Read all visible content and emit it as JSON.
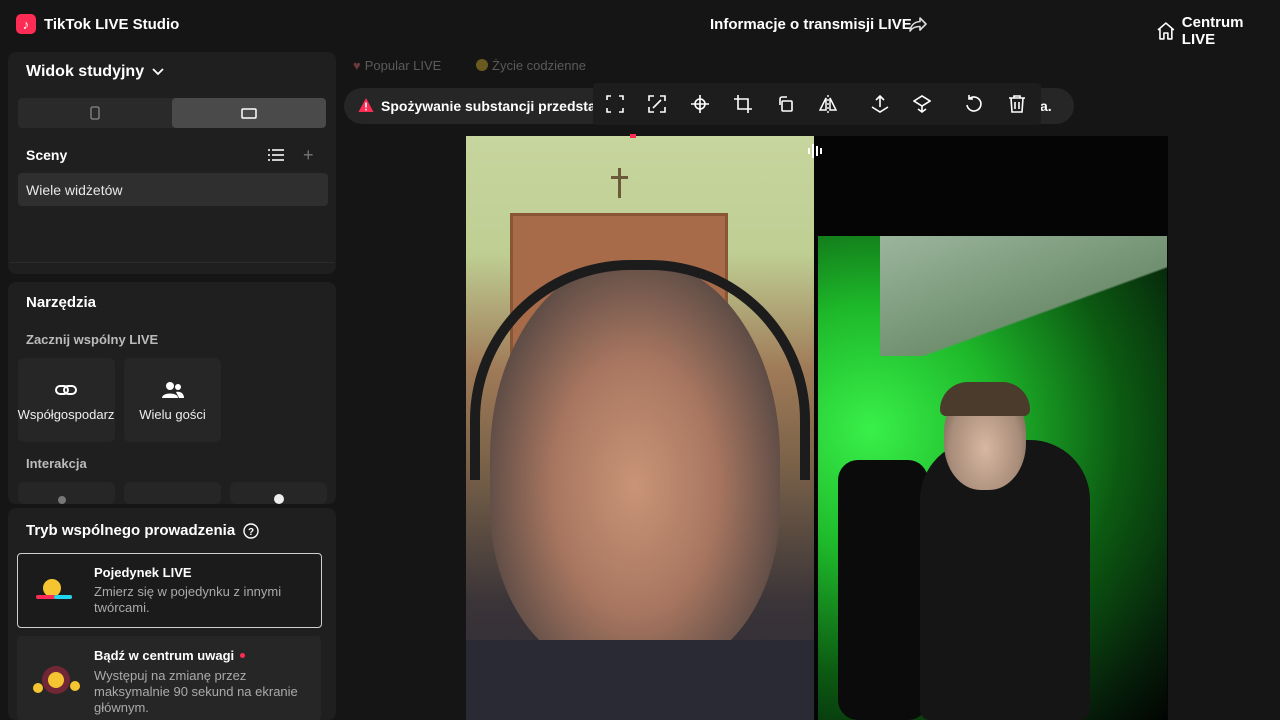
{
  "app": {
    "title": "TikTok LIVE Studio",
    "logo_icon": "tiktok-logo",
    "live_info": "Informacje o transmisji LIVE",
    "centrum": "Centrum LIVE",
    "accent_color": "#fe2c55"
  },
  "sidebar": {
    "studio_view": "Widok studyjny",
    "scenes_label": "Sceny",
    "scene_item": "Wiele widżetów",
    "tools_title": "Narzędzia",
    "cohost_label": "Zacznij wspólny LIVE",
    "cohost_tiles": [
      {
        "label": "Współgospodarz",
        "icon": "link-icon"
      },
      {
        "label": "Wielu gości",
        "icon": "users-icon"
      }
    ],
    "interaction_label": "Interakcja",
    "mode_title": "Tryb wspólnego prowadzenia",
    "cards": [
      {
        "title": "Pojedynek LIVE",
        "desc": "Zmierz się w pojedynku z innymi twórcami."
      },
      {
        "title": "Bądź w centrum uwagi",
        "desc": "Występuj na zmianę przez maksymalnie 90 sekund na ekranie głównym."
      }
    ]
  },
  "main": {
    "chips": [
      "Popular LIVE",
      "Życie codzienne"
    ],
    "warning_text": "Spożywanie substancji przedsta",
    "warning_tail": "a."
  }
}
